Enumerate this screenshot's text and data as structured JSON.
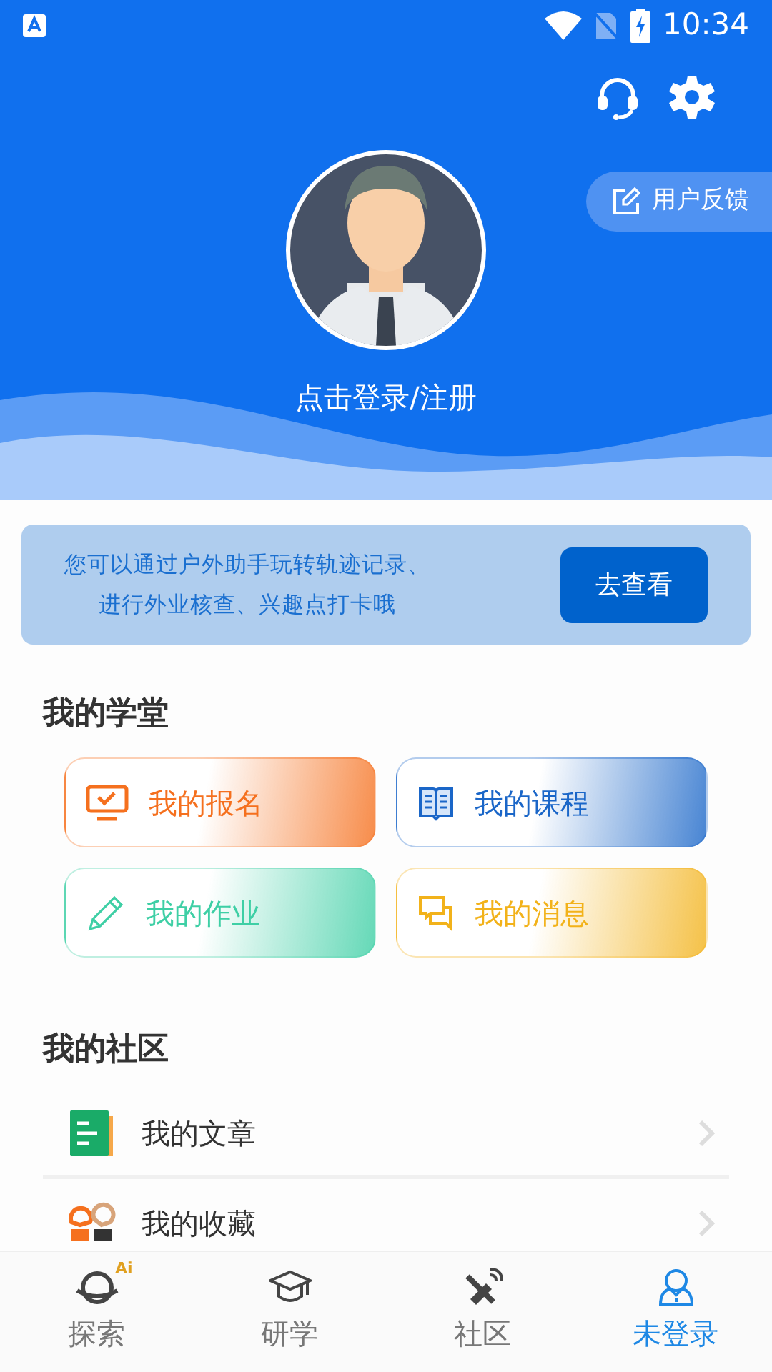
{
  "status_bar": {
    "time": "10:34"
  },
  "header": {
    "login_text": "点击登录/注册",
    "feedback_button": "用户反馈"
  },
  "banner": {
    "lines": [
      "您可以通过户外助手玩转轨迹记录、",
      "进行外业核查、兴趣点打卡哦"
    ],
    "button": "去查看"
  },
  "school": {
    "title": "我的学堂",
    "cards": [
      {
        "label": "我的报名",
        "color": "#f5701e"
      },
      {
        "label": "我的课程",
        "color": "#1a66c8"
      },
      {
        "label": "我的作业",
        "color": "#3ecfa5"
      },
      {
        "label": "我的消息",
        "color": "#f2b21a"
      }
    ]
  },
  "community": {
    "title": "我的社区",
    "items": [
      {
        "label": "我的文章"
      },
      {
        "label": "我的收藏"
      }
    ]
  },
  "tab_bar": [
    {
      "label": "探索",
      "badge": "Ai",
      "selected": false
    },
    {
      "label": "研学",
      "selected": false
    },
    {
      "label": "社区",
      "selected": false
    },
    {
      "label": "未登录",
      "selected": true
    }
  ]
}
